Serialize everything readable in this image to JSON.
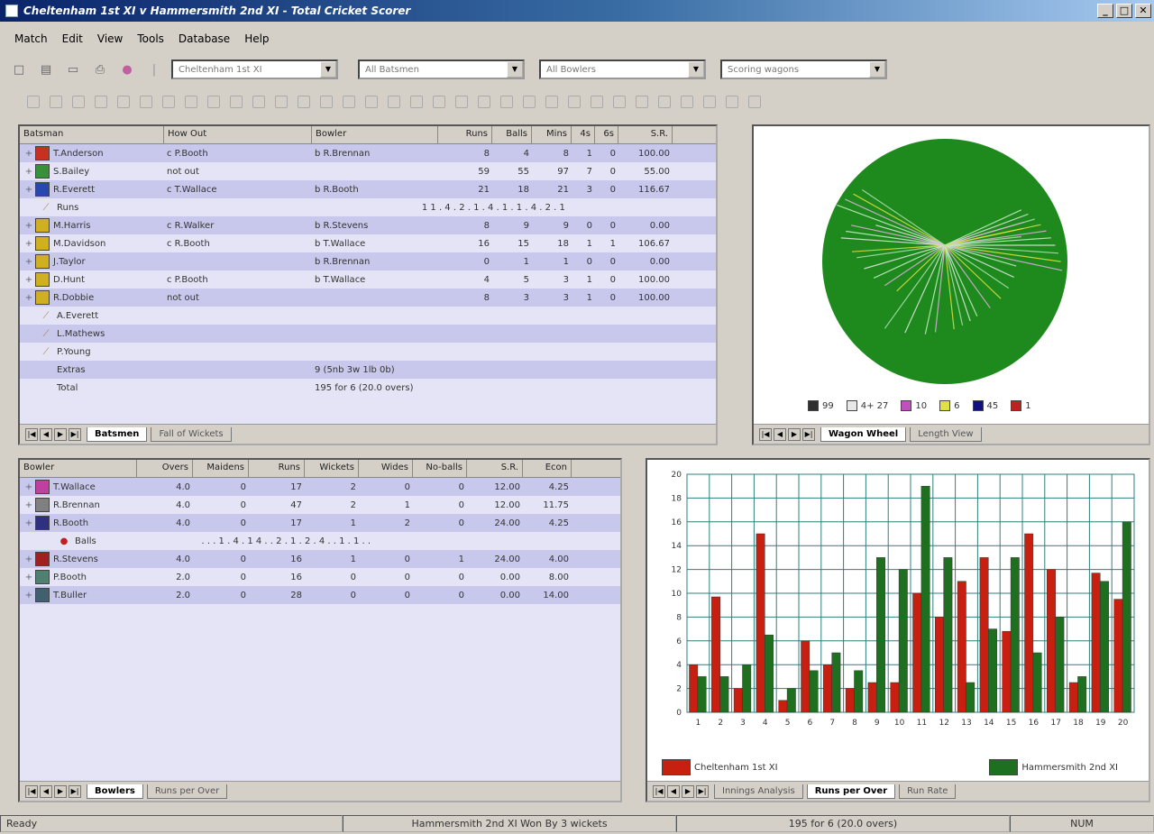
{
  "window": {
    "title": "Cheltenham 1st XI v Hammersmith 2nd XI - Total Cricket Scorer"
  },
  "menu": [
    "Match",
    "Edit",
    "View",
    "Tools",
    "Database",
    "Help"
  ],
  "toolbar": {
    "combo_innings": "Cheltenham 1st XI",
    "combo_batsmen": "All Batsmen",
    "combo_bowlers": "All Bowlers",
    "combo_view": "Scoring wagons",
    "icons": [
      "new-icon",
      "open-icon",
      "save-icon",
      "print-icon",
      "stats-icon"
    ],
    "row2_count": 33
  },
  "batting": {
    "headers": [
      "Batsman",
      "How Out",
      "Bowler",
      "Runs",
      "Balls",
      "Mins",
      "4s",
      "6s",
      "S.R."
    ],
    "rows": [
      {
        "name": "T.Anderson",
        "how": "c P.Booth",
        "bowler": "b R.Brennan",
        "runs": "8",
        "balls": "4",
        "mins": "8",
        "fours": "1",
        "sixes": "0",
        "sr": "100.00",
        "hl": true,
        "color": "#c83020"
      },
      {
        "name": "S.Bailey",
        "how": "not out",
        "bowler": "",
        "runs": "59",
        "balls": "55",
        "mins": "97",
        "fours": "7",
        "sixes": "0",
        "sr": "55.00",
        "hl": false,
        "color": "#389038"
      },
      {
        "name": "R.Everett",
        "how": "c T.Wallace",
        "bowler": "b R.Booth",
        "runs": "21",
        "balls": "18",
        "mins": "21",
        "fours": "3",
        "sixes": "0",
        "sr": "116.67",
        "hl": true,
        "color": "#2848b0"
      },
      {
        "name": "Runs",
        "how": "",
        "bowler": "",
        "runs": "1 1 . 4 . 2 . 1 . 4 . 1 . 1 . 4 . 2 . 1",
        "balls": "",
        "mins": "",
        "fours": "",
        "sixes": "",
        "sr": "",
        "hl": false,
        "sub": true
      },
      {
        "name": "M.Harris",
        "how": "c R.Walker",
        "bowler": "b R.Stevens",
        "runs": "8",
        "balls": "9",
        "mins": "9",
        "fours": "0",
        "sixes": "0",
        "sr": "0.00",
        "hl": true,
        "color": "#d0b020"
      },
      {
        "name": "M.Davidson",
        "how": "c R.Booth",
        "bowler": "b T.Wallace",
        "runs": "16",
        "balls": "15",
        "mins": "18",
        "fours": "1",
        "sixes": "1",
        "sr": "106.67",
        "hl": false,
        "color": "#d0b020"
      },
      {
        "name": "J.Taylor",
        "how": "",
        "bowler": "b R.Brennan",
        "runs": "0",
        "balls": "1",
        "mins": "1",
        "fours": "0",
        "sixes": "0",
        "sr": "0.00",
        "hl": true,
        "color": "#d0b020"
      },
      {
        "name": "D.Hunt",
        "how": "c P.Booth",
        "bowler": "b T.Wallace",
        "runs": "4",
        "balls": "5",
        "mins": "3",
        "fours": "1",
        "sixes": "0",
        "sr": "100.00",
        "hl": false,
        "color": "#d0b020"
      },
      {
        "name": "R.Dobbie",
        "how": "not out",
        "bowler": "",
        "runs": "8",
        "balls": "3",
        "mins": "3",
        "fours": "1",
        "sixes": "0",
        "sr": "100.00",
        "hl": true,
        "color": "#d0b020"
      },
      {
        "name": "A.Everett",
        "how": "",
        "bowler": "",
        "runs": "",
        "balls": "",
        "mins": "",
        "fours": "",
        "sixes": "",
        "sr": "",
        "hl": false
      },
      {
        "name": "L.Mathews",
        "how": "",
        "bowler": "",
        "runs": "",
        "balls": "",
        "mins": "",
        "fours": "",
        "sixes": "",
        "sr": "",
        "hl": true
      },
      {
        "name": "P.Young",
        "how": "",
        "bowler": "",
        "runs": "",
        "balls": "",
        "mins": "",
        "fours": "",
        "sixes": "",
        "sr": "",
        "hl": false
      },
      {
        "name": "Extras",
        "how": "",
        "bowler": "9 (5nb 3w 1lb 0b)",
        "runs": "",
        "balls": "",
        "mins": "",
        "fours": "",
        "sixes": "",
        "sr": "",
        "hl": true,
        "plain": true
      },
      {
        "name": "Total",
        "how": "",
        "bowler": "195 for 6 (20.0 overs)",
        "runs": "",
        "balls": "",
        "mins": "",
        "fours": "",
        "sixes": "",
        "sr": "",
        "hl": false,
        "plain": true
      }
    ],
    "tabs": [
      "Batsmen",
      "Fall of Wickets"
    ]
  },
  "wagon": {
    "legend": [
      {
        "label": "99",
        "color": "#303030"
      },
      {
        "label": "4+ 27",
        "color": "#e8e8e8"
      },
      {
        "label": "10",
        "color": "#c050c0"
      },
      {
        "label": "6",
        "color": "#e0e040"
      },
      {
        "label": "45",
        "color": "#101080"
      },
      {
        "label": "1",
        "color": "#c02020"
      }
    ],
    "tabs": [
      "Wagon Wheel",
      "Length View"
    ]
  },
  "bowling": {
    "headers": [
      "Bowler",
      "Overs",
      "Maidens",
      "Runs",
      "Wickets",
      "Wides",
      "No-balls",
      "S.R.",
      "Econ"
    ],
    "rows": [
      {
        "name": "T.Wallace",
        "overs": "4.0",
        "maidens": "0",
        "runs": "17",
        "wkts": "2",
        "wides": "0",
        "nb": "0",
        "sr": "12.00",
        "econ": "4.25",
        "hl": true,
        "color": "#c040a0"
      },
      {
        "name": "R.Brennan",
        "overs": "4.0",
        "maidens": "0",
        "runs": "47",
        "wkts": "2",
        "wides": "1",
        "nb": "0",
        "sr": "12.00",
        "econ": "11.75",
        "hl": false,
        "color": "#808080"
      },
      {
        "name": "R.Booth",
        "overs": "4.0",
        "maidens": "0",
        "runs": "17",
        "wkts": "1",
        "wides": "2",
        "nb": "0",
        "sr": "24.00",
        "econ": "4.25",
        "hl": true,
        "color": "#303080"
      },
      {
        "name": "Balls",
        "overs": "",
        "maidens": "",
        "runs": ". . . 1 . 4 . 1 4 . . 2 . 1 . 2 . 4 . . 1 . 1 . .",
        "wkts": "",
        "wides": "",
        "nb": "",
        "sr": "",
        "econ": "",
        "hl": false,
        "sub": true
      },
      {
        "name": "R.Stevens",
        "overs": "4.0",
        "maidens": "0",
        "runs": "16",
        "wkts": "1",
        "wides": "0",
        "nb": "1",
        "sr": "24.00",
        "econ": "4.00",
        "hl": true,
        "color": "#a02020"
      },
      {
        "name": "P.Booth",
        "overs": "2.0",
        "maidens": "0",
        "runs": "16",
        "wkts": "0",
        "wides": "0",
        "nb": "0",
        "sr": "0.00",
        "econ": "8.00",
        "hl": false,
        "color": "#508070"
      },
      {
        "name": "T.Buller",
        "overs": "2.0",
        "maidens": "0",
        "runs": "28",
        "wkts": "0",
        "wides": "0",
        "nb": "0",
        "sr": "0.00",
        "econ": "14.00",
        "hl": true,
        "color": "#406070"
      }
    ],
    "tabs": [
      "Bowlers",
      "Runs per Over"
    ]
  },
  "chart_data": {
    "type": "bar",
    "categories": [
      "1",
      "2",
      "3",
      "4",
      "5",
      "6",
      "7",
      "8",
      "9",
      "10",
      "11",
      "12",
      "13",
      "14",
      "15",
      "16",
      "17",
      "18",
      "19",
      "20"
    ],
    "ylim": [
      0,
      20
    ],
    "yticks": [
      "0",
      "2",
      "4",
      "6",
      "8",
      "10",
      "12",
      "14",
      "16",
      "18",
      "20"
    ],
    "series": [
      {
        "name": "Cheltenham 1st XI",
        "color": "#c82010",
        "values": [
          4,
          9.7,
          2,
          15,
          1,
          6,
          4,
          2,
          2.5,
          2.5,
          10,
          8,
          11,
          13,
          6.8,
          15,
          12,
          2.5,
          11.7,
          9.5
        ]
      },
      {
        "name": "Hammersmith 2nd XI",
        "color": "#1e7020",
        "values": [
          3,
          3,
          4,
          6.5,
          2,
          3.5,
          5,
          3.5,
          13,
          12,
          19,
          13,
          2.5,
          7,
          13,
          5,
          8,
          3,
          11,
          16
        ]
      }
    ],
    "tabs": [
      "Innings Analysis",
      "Runs per Over",
      "Run Rate"
    ]
  },
  "status": {
    "left": "Ready",
    "mid": "Hammersmith 2nd XI Won By 3 wickets",
    "right": "195 for 6 (20.0 overs)",
    "num": "NUM"
  }
}
